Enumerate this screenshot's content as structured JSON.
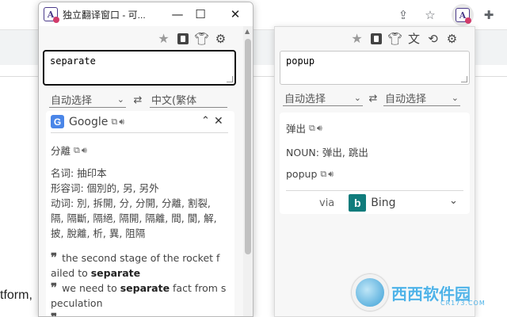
{
  "browser": {
    "page_text": "tform,"
  },
  "window": {
    "title": "独立翻译窗口 - 可...",
    "controls": {
      "minimize": "—",
      "maximize": "☐",
      "close": "✕"
    },
    "input_value": "separate",
    "source_lang": "自动选择",
    "target_lang": "中文(繁体",
    "swap_glyph": "⇄",
    "engine": {
      "logo_letter": "G",
      "name": "Google"
    },
    "result": {
      "word": "分離",
      "pos_lines": [
        "名词: 抽印本",
        "形容词: 個別的, 另, 另外",
        "动词: 別, 拆開, 分, 分開, 分離, 割裂,",
        "隔, 隔斷, 隔絕, 隔開, 隔離, 間, 閬, 解,",
        "披, 脫離, 析, 異, 阻隔"
      ],
      "examples": [
        {
          "line1": "the second stage of the rocket f",
          "line2_pre": "ailed to ",
          "line2_bold": "separate"
        },
        {
          "line1_pre": "we need to ",
          "line1_bold": "separate",
          "line1_post": " fact from s",
          "line2": "peculation"
        }
      ]
    }
  },
  "popup": {
    "input_value": "popup",
    "source_lang": "自动选择",
    "target_lang": "自动选择",
    "swap_glyph": "⇄",
    "result": {
      "word": "弹出",
      "noun_line": "NOUN: 弹出, 跳出",
      "original": "popup"
    },
    "via_label": "via",
    "engine": {
      "logo_letter": "b",
      "name": "Bing"
    }
  },
  "watermark": {
    "text": "西西软件园",
    "sub": "CR173.COM"
  },
  "colors": {
    "google_blue": "#4a86e8",
    "bing_teal": "#107c7c",
    "ext_purple": "#4a3a8a"
  }
}
